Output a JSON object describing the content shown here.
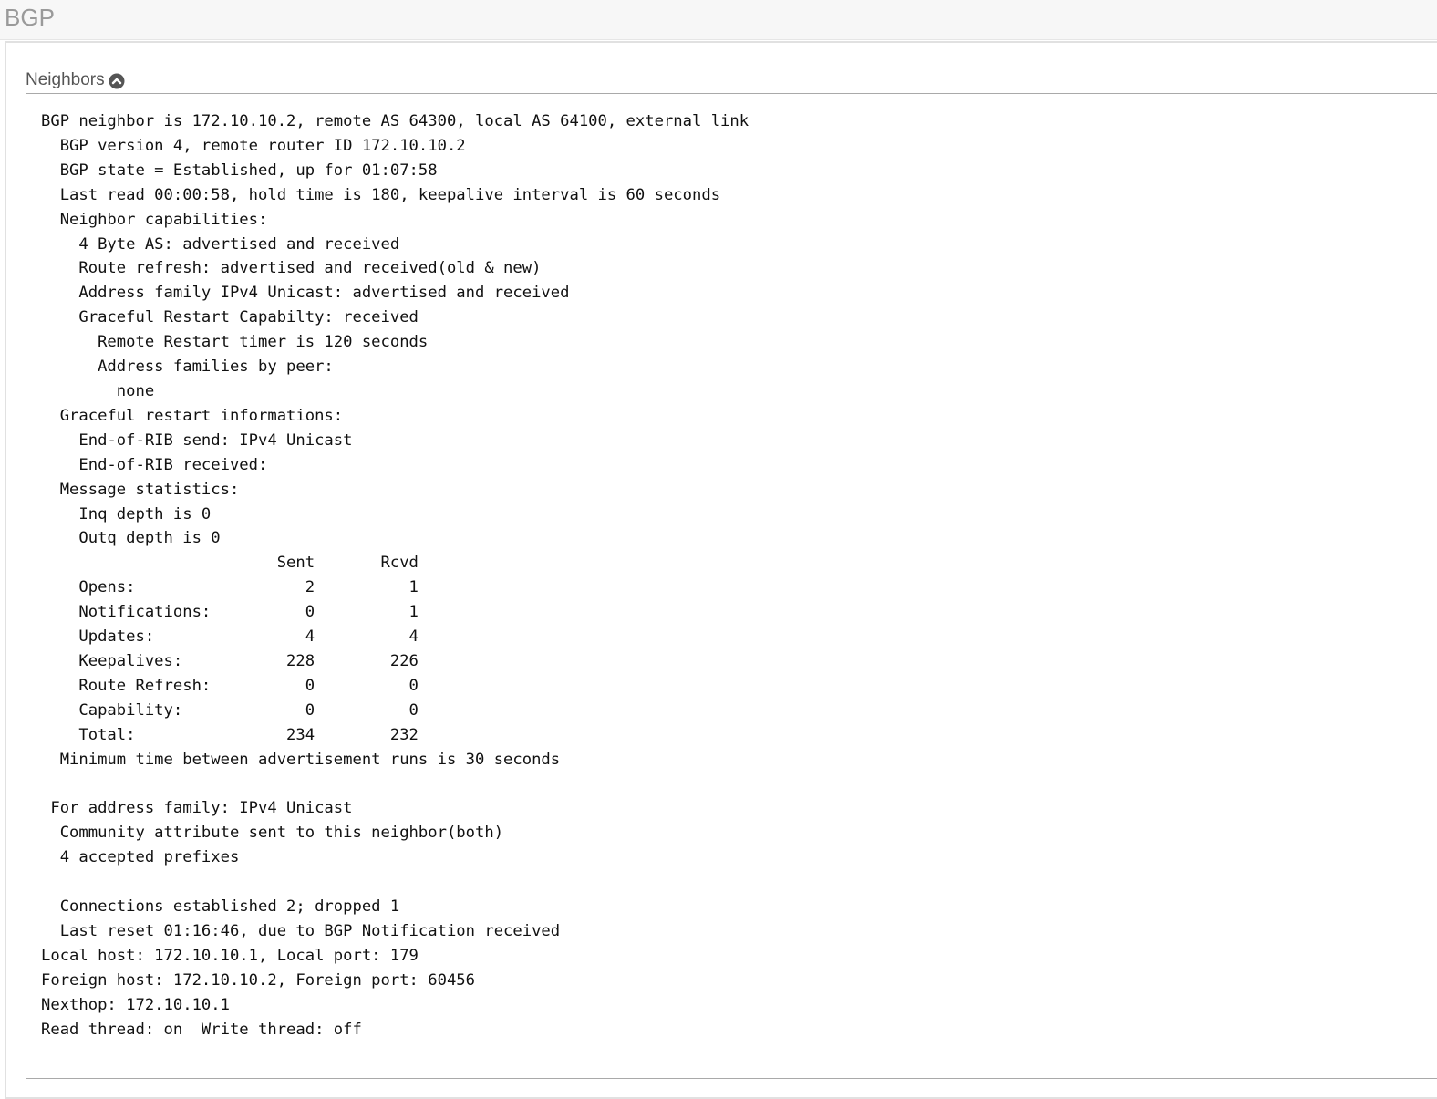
{
  "page": {
    "title": "BGP"
  },
  "section": {
    "label": "Neighbors",
    "toggle_icon": "chevron-up-circle-icon"
  },
  "neighbor_output": {
    "text": "BGP neighbor is 172.10.10.2, remote AS 64300, local AS 64100, external link\n  BGP version 4, remote router ID 172.10.10.2\n  BGP state = Established, up for 01:07:58\n  Last read 00:00:58, hold time is 180, keepalive interval is 60 seconds\n  Neighbor capabilities:\n    4 Byte AS: advertised and received\n    Route refresh: advertised and received(old & new)\n    Address family IPv4 Unicast: advertised and received\n    Graceful Restart Capabilty: received\n      Remote Restart timer is 120 seconds\n      Address families by peer:\n        none\n  Graceful restart informations:\n    End-of-RIB send: IPv4 Unicast\n    End-of-RIB received:\n  Message statistics:\n    Inq depth is 0\n    Outq depth is 0\n                         Sent       Rcvd\n    Opens:                  2          1\n    Notifications:          0          1\n    Updates:                4          4\n    Keepalives:           228        226\n    Route Refresh:          0          0\n    Capability:             0          0\n    Total:                234        232\n  Minimum time between advertisement runs is 30 seconds\n\n For address family: IPv4 Unicast\n  Community attribute sent to this neighbor(both)\n  4 accepted prefixes\n\n  Connections established 2; dropped 1\n  Last reset 01:16:46, due to BGP Notification received\nLocal host: 172.10.10.1, Local port: 179\nForeign host: 172.10.10.2, Foreign port: 60456\nNexthop: 172.10.10.1\nRead thread: on  Write thread: off"
  }
}
